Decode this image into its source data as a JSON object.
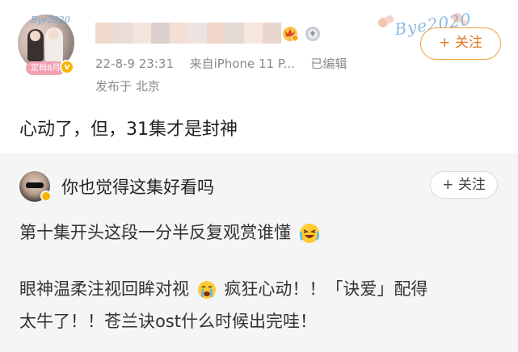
{
  "post": {
    "avatar_script": "Bye2020",
    "member_badge": "定档8月",
    "verified_mark": "v",
    "timestamp": "22-8-9 23:31",
    "source": "来自iPhone 11 P...",
    "edited": "已编辑",
    "location": "发布于 北京",
    "deco_text": "Bye2020",
    "follow_label": "+ 关注",
    "content": "心动了，但，31集才是封神",
    "icons": [
      "crown-badge-icon",
      "medal-badge-icon"
    ]
  },
  "repost": {
    "author_name": "你也觉得这集好看吗",
    "follow_label": "+ 关注",
    "line1": "第十集开头这段一分半反复观赏谁懂",
    "line2_before": "眼神温柔注视回眸对视",
    "line2_after": "疯狂心动！！「诀爱」配得",
    "line3": "太牛了！！苍兰诀ost什么时候出完哇！",
    "emojis": [
      "crying-laughing-emoji",
      "crying-emoji"
    ]
  },
  "colors": {
    "follow_main": "#f0a03c",
    "meta_gray": "#8a8a8a",
    "repost_bg": "#f5f5f5",
    "verify_gold": "#f7b500"
  }
}
